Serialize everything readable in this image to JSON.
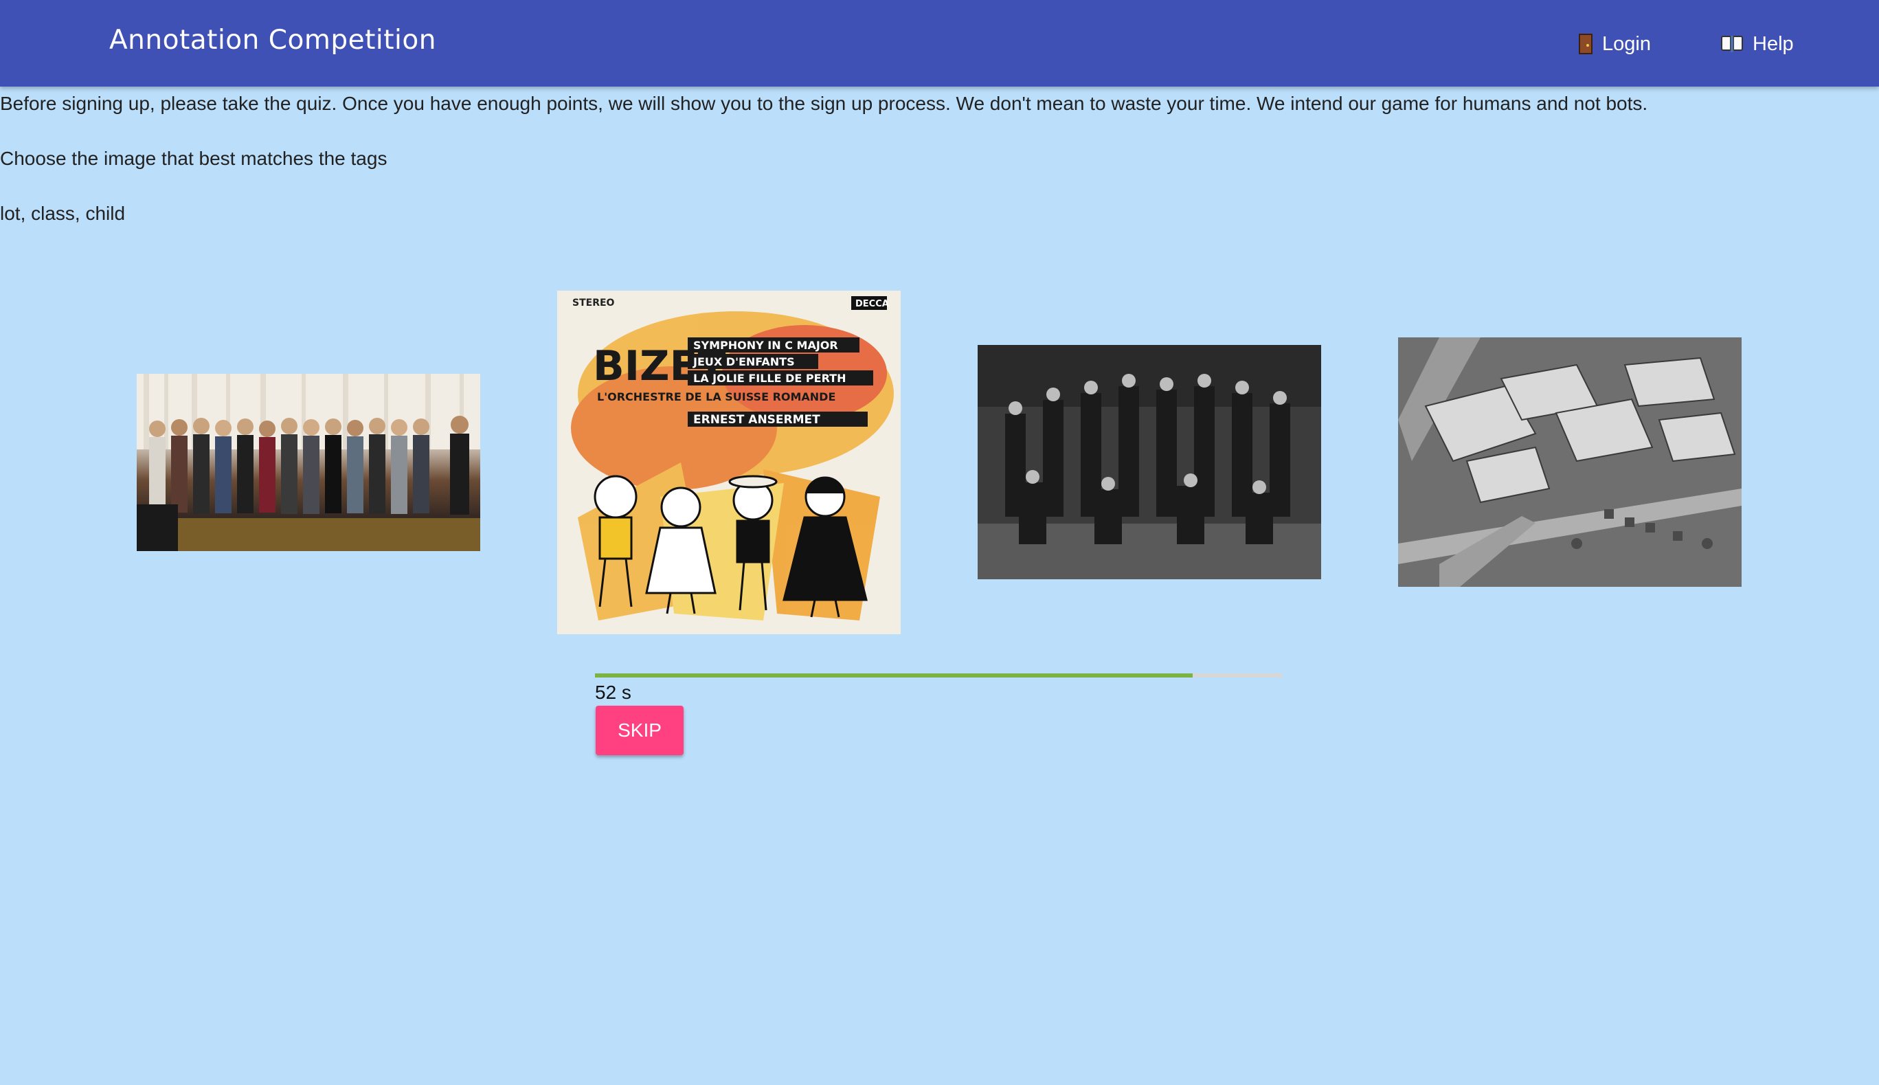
{
  "header": {
    "title": "Annotation Competition",
    "nav": [
      {
        "icon": "door-icon",
        "label": "Login"
      },
      {
        "icon": "book-icon",
        "label": "Help"
      }
    ]
  },
  "intro": "Before signing up, please take the quiz. Once you have enough points, we will show you to the sign up process. We don't mean to waste your time. We intend our game for humans and not bots.",
  "instruction": "Choose the image that best matches the tags",
  "tags": "lot, class, child",
  "album_cover": {
    "top_line": "STEREO",
    "brand": "DECCA",
    "composer": "BIZET",
    "works": [
      "SYMPHONY IN C MAJOR",
      "JEUX D'ENFANTS",
      "LA JOLIE FILLE DE PERTH"
    ],
    "orchestra": "L'ORCHESTRE DE LA SUISSE ROMANDE",
    "conductor": "ERNEST ANSERMET"
  },
  "timer": {
    "progress": 0.87,
    "label": "52 s"
  },
  "skip_label": "SKIP",
  "colors": {
    "appbar": "#3f51b5",
    "background": "#bbdefb",
    "progress": "#7cb342",
    "skip": "#ff4081"
  }
}
